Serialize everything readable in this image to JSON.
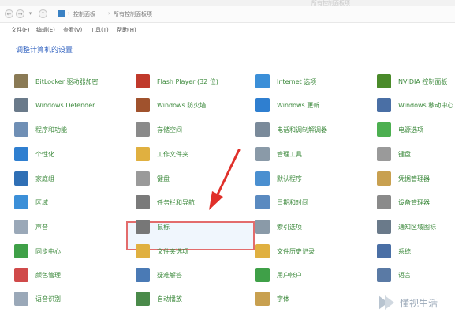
{
  "window": {
    "title": "所有控制面板项"
  },
  "address": {
    "crumbs": [
      "控制面板",
      "所有控制面板项"
    ]
  },
  "menu": [
    "文件(F)",
    "编辑(E)",
    "查看(V)",
    "工具(T)",
    "帮助(H)"
  ],
  "heading": "调整计算机的设置",
  "items": [
    {
      "label": "BitLocker 驱动器加密",
      "color": "#8a7a55"
    },
    {
      "label": "Flash Player (32 位)",
      "color": "#c0392b"
    },
    {
      "label": "Internet 选项",
      "color": "#3b8fd8"
    },
    {
      "label": "NVIDIA 控制面板",
      "color": "#4a8a2a"
    },
    {
      "label": "Windows Defender",
      "color": "#6a7a8a"
    },
    {
      "label": "Windows 防火墙",
      "color": "#a0522d"
    },
    {
      "label": "Windows 更新",
      "color": "#2f7fd0"
    },
    {
      "label": "Windows 移动中心",
      "color": "#4a6fa5"
    },
    {
      "label": "程序和功能",
      "color": "#6f8fb5"
    },
    {
      "label": "存储空间",
      "color": "#8a8a8a"
    },
    {
      "label": "电话和调制解调器",
      "color": "#7a8a9a"
    },
    {
      "label": "电源选项",
      "color": "#4caf50"
    },
    {
      "label": "个性化",
      "color": "#2f7fd0"
    },
    {
      "label": "工作文件夹",
      "color": "#e0b040"
    },
    {
      "label": "管理工具",
      "color": "#8a9aa8"
    },
    {
      "label": "键盘",
      "color": "#9a9a9a"
    },
    {
      "label": "家庭组",
      "color": "#2f6fb5"
    },
    {
      "label": "键盘",
      "color": "#9a9a9a"
    },
    {
      "label": "默认程序",
      "color": "#4a8fd0"
    },
    {
      "label": "凭据管理器",
      "color": "#c8a050"
    },
    {
      "label": "区域",
      "color": "#3b8fd8"
    },
    {
      "label": "任务栏和导航",
      "color": "#7a7a7a"
    },
    {
      "label": "日期和时间",
      "color": "#5a8ac0"
    },
    {
      "label": "设备管理器",
      "color": "#8a8a8a"
    },
    {
      "label": "声音",
      "color": "#9aa8b8"
    },
    {
      "label": "鼠标",
      "color": "#777777"
    },
    {
      "label": "索引选项",
      "color": "#8a9aa8"
    },
    {
      "label": "通知区域图标",
      "color": "#6a7a8a"
    },
    {
      "label": "同步中心",
      "color": "#3fa048"
    },
    {
      "label": "文件夹选项",
      "color": "#e0b040"
    },
    {
      "label": "文件历史记录",
      "color": "#e0b040"
    },
    {
      "label": "系统",
      "color": "#4a6fa5"
    },
    {
      "label": "颜色管理",
      "color": "#d04a4a"
    },
    {
      "label": "疑难解答",
      "color": "#4a7ab5"
    },
    {
      "label": "用户帐户",
      "color": "#3fa048"
    },
    {
      "label": "语言",
      "color": "#5a7aa5"
    },
    {
      "label": "语音识别",
      "color": "#9aa8b8"
    },
    {
      "label": "自动播放",
      "color": "#4a8a4a"
    },
    {
      "label": "字体",
      "color": "#c8a050"
    }
  ],
  "watermark": {
    "text": "懂视生活"
  }
}
